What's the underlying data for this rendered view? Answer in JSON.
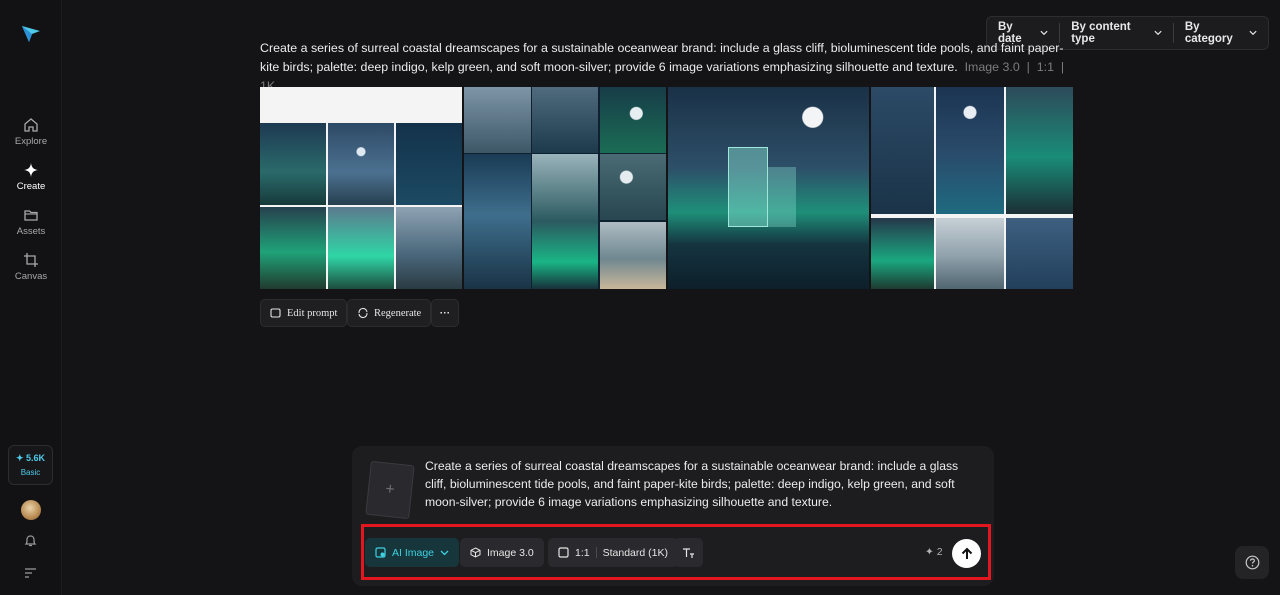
{
  "sidebar": {
    "items": [
      {
        "label": "Explore",
        "icon": "home-icon"
      },
      {
        "label": "Create",
        "icon": "sparkle-icon"
      },
      {
        "label": "Assets",
        "icon": "folder-icon"
      },
      {
        "label": "Canvas",
        "icon": "crop-icon"
      }
    ],
    "credits": {
      "value": "✦ 5.6K",
      "plan": "Basic"
    }
  },
  "filters": {
    "date": "By date",
    "content_type": "By content type",
    "category": "By category"
  },
  "result": {
    "prompt": "Create a series of surreal coastal dreamscapes for a sustainable oceanwear brand: include a glass cliff, bioluminescent tide pools, and faint paper-kite birds; palette: deep indigo, kelp green, and soft moon-silver; provide 6 image variations emphasizing silhouette and texture.",
    "model": "Image 3.0",
    "ratio": "1:1",
    "resolution": "1K",
    "edit_label": "Edit prompt",
    "regenerate_label": "Regenerate",
    "more_label": "···"
  },
  "composer": {
    "text": "Create a series of surreal coastal dreamscapes for a sustainable oceanwear brand: include a glass cliff, bioluminescent tide pools, and faint paper-kite birds; palette: deep indigo, kelp green, and soft moon-silver; provide 6 image variations emphasizing silhouette and texture.",
    "add_symbol": "+",
    "mode": "AI Image",
    "model": "Image 3.0",
    "ratio": "1:1",
    "quality": "Standard (1K)",
    "cost": "✦ 2"
  },
  "colors": {
    "accent": "#3fd0e0",
    "highlight": "#e3151f",
    "background": "#141416"
  }
}
